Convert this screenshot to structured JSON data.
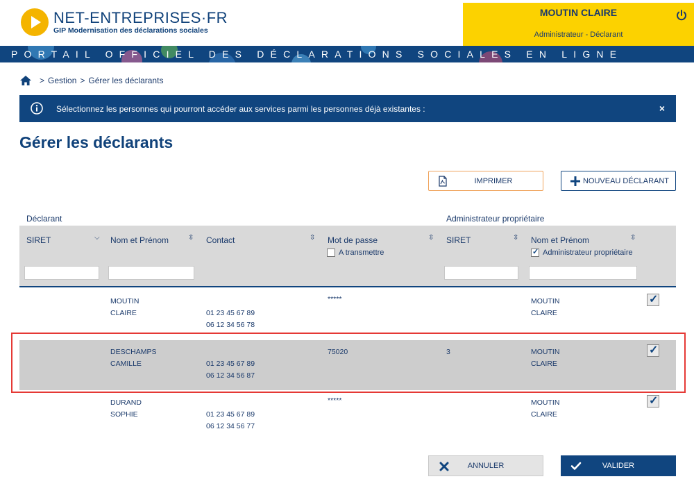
{
  "header": {
    "logo_main": "NET-ENTREPRISES·FR",
    "logo_sub": "GIP Modernisation des déclarations sociales",
    "user_name": "MOUTIN CLAIRE",
    "user_role": "Administrateur - Déclarant",
    "power_icon": "power-icon"
  },
  "band": {
    "text": "PORTAIL OFFICIEL DES DÉCLARATIONS SOCIALES EN LIGNE"
  },
  "breadcrumb": {
    "home_icon": "home-icon",
    "items": [
      "Gestion",
      "Gérer les déclarants"
    ],
    "separator": ">"
  },
  "alert": {
    "text": "Sélectionnez les personnes qui pourront accéder aux services parmi les personnes déjà existantes :",
    "close": "×"
  },
  "page": {
    "title": "Gérer les déclarants"
  },
  "actions": {
    "print_label": "IMPRIMER",
    "new_label": "NOUVEAU DÉCLARANT"
  },
  "table": {
    "group_declarant": "Déclarant",
    "group_admin": "Administrateur propriétaire",
    "columns": {
      "siret": "SIRET",
      "nom_prenom": "Nom et Prénom",
      "contact": "Contact",
      "mot_de_passe": "Mot de passe",
      "a_transmettre": "A transmettre",
      "admin_siret": "SIRET",
      "admin_nom_prenom": "Nom et Prénom",
      "admin_proprietaire": "Administrateur propriétaire"
    },
    "rows": [
      {
        "nom": "MOUTIN",
        "prenom": "CLAIRE",
        "tel1": "01 23 45 67 89",
        "tel2": "06 12 34 56 78",
        "password": "*****",
        "admin_siret": "",
        "admin_nom": "MOUTIN",
        "admin_prenom": "CLAIRE",
        "checked": true
      },
      {
        "nom": "DESCHAMPS",
        "prenom": "CAMILLE",
        "tel1": "01 23 45 67 89",
        "tel2": "06 12 34 56 87",
        "password": "75020",
        "admin_siret": "3",
        "admin_nom": "MOUTIN",
        "admin_prenom": "CLAIRE",
        "checked": true
      },
      {
        "nom": "DURAND",
        "prenom": "SOPHIE",
        "tel1": "01 23 45 67 89",
        "tel2": "06 12 34 56 77",
        "password": "*****",
        "admin_siret": "",
        "admin_nom": "MOUTIN",
        "admin_prenom": "CLAIRE",
        "checked": true
      }
    ]
  },
  "footer": {
    "cancel_label": "ANNULER",
    "validate_label": "VALIDER"
  },
  "colors": {
    "brand_blue": "#10457f",
    "accent_yellow": "#fcd200",
    "print_border": "#f0a35b",
    "selection_red": "#e53935"
  }
}
